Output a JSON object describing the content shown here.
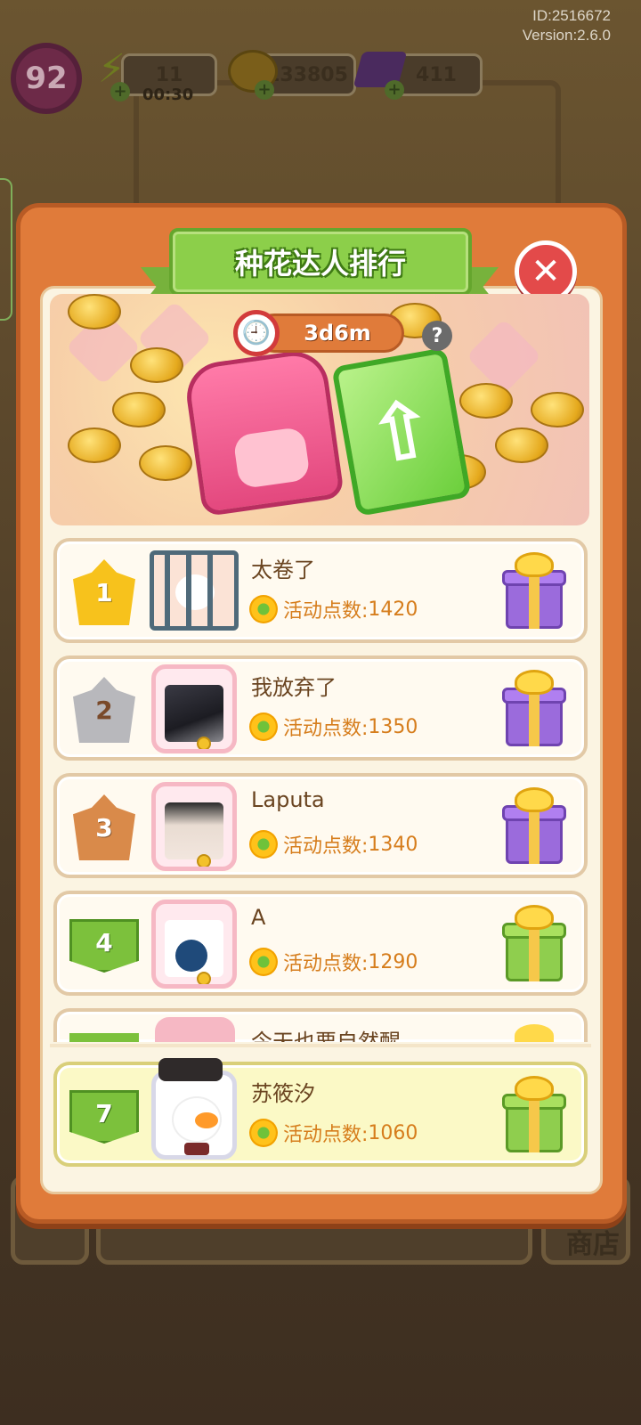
{
  "header": {
    "id_text": "ID:2516672",
    "version_text": "Version:2.6.0"
  },
  "hud": {
    "level": "92",
    "energy": "11",
    "energy_timer": "00:30",
    "coins": "133805",
    "gems": "411",
    "icons": [
      "lightning-icon",
      "coin-icon",
      "gem-icon",
      "plus-icon"
    ]
  },
  "modal": {
    "title": "种花达人排行",
    "countdown": "3d6m",
    "close_icon": "close-icon",
    "help_label": "?"
  },
  "leaderboard": {
    "points_label": "活动点数:",
    "rows": [
      {
        "rank": "1",
        "name": "太卷了",
        "points": "1420",
        "rank_style": "gold-crown",
        "gift": "purple-gift"
      },
      {
        "rank": "2",
        "name": "我放弃了",
        "points": "1350",
        "rank_style": "silver-crown",
        "gift": "purple-gift"
      },
      {
        "rank": "3",
        "name": "Laputa",
        "points": "1340",
        "rank_style": "bronze-crown",
        "gift": "purple-gift"
      },
      {
        "rank": "4",
        "name": "A",
        "points": "1290",
        "rank_style": "green-flag",
        "gift": "green-gift"
      },
      {
        "rank": "",
        "name": "今天也要自然醒",
        "points": "",
        "rank_style": "green-flag",
        "gift": "green-gift"
      }
    ],
    "self_row": {
      "rank": "7",
      "name": "苏筱汐",
      "points": "1060",
      "rank_style": "green-flag",
      "gift": "green-gift"
    }
  },
  "colors": {
    "modal_orange": "#e07b3a",
    "title_green": "#8ccf4a",
    "points_orange": "#d67d1c",
    "self_highlight": "#fbf9c6"
  },
  "background": {
    "shop_label": "商店"
  }
}
